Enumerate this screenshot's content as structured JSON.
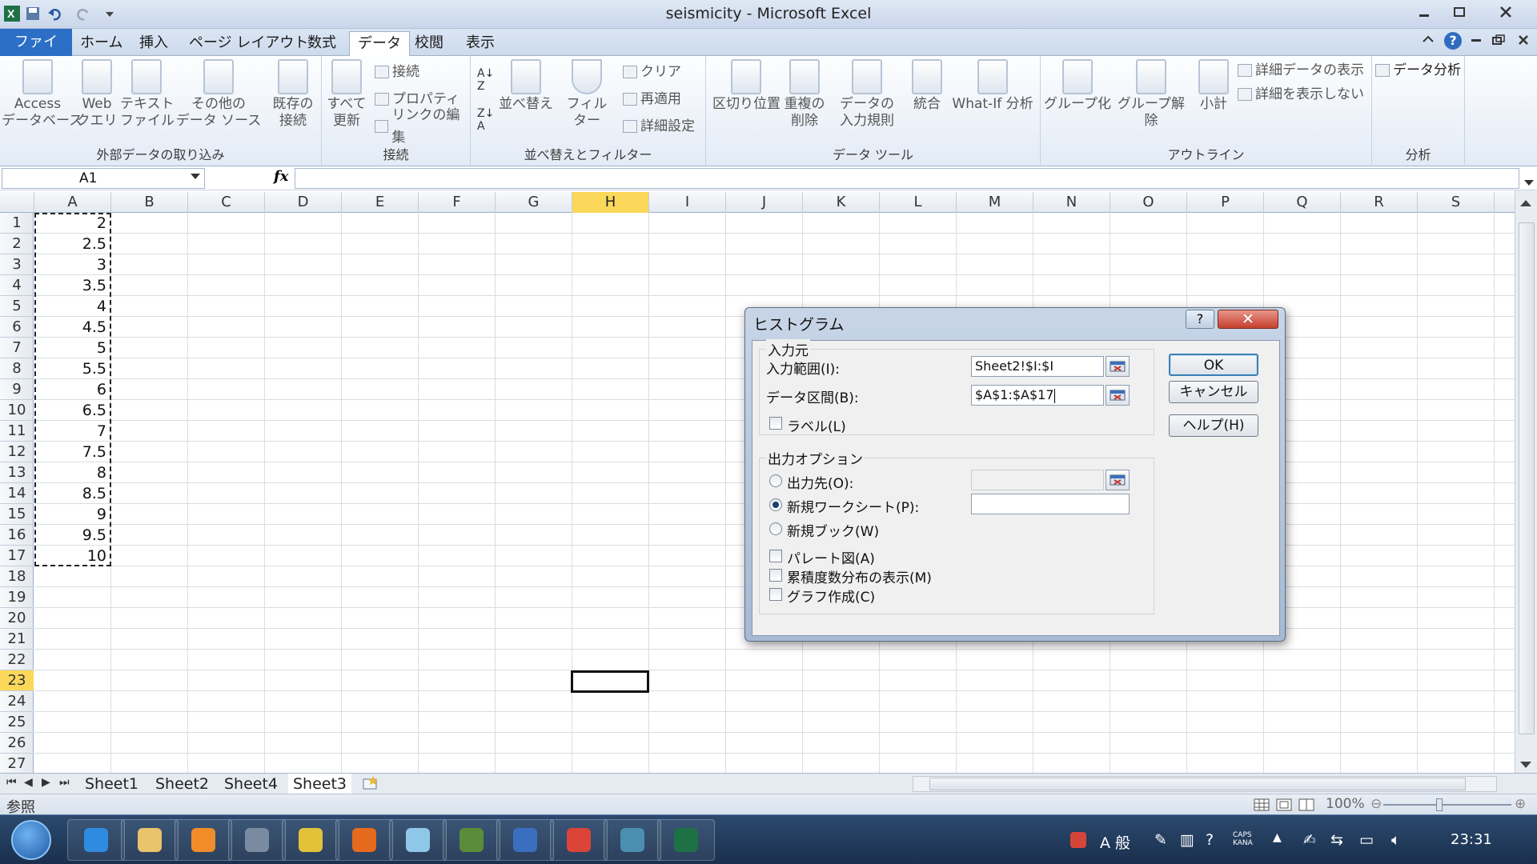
{
  "window": {
    "title": "seismicity - Microsoft Excel"
  },
  "tabs": [
    {
      "label": "ファイル"
    },
    {
      "label": "ホーム"
    },
    {
      "label": "挿入"
    },
    {
      "label": "ページ レイアウト"
    },
    {
      "label": "数式"
    },
    {
      "label": "データ"
    },
    {
      "label": "校閲"
    },
    {
      "label": "表示"
    }
  ],
  "ribbon": {
    "groups": {
      "external": "外部データの取り込み",
      "connections": "接続",
      "sortfilter": "並べ替えとフィルター",
      "datatools": "データ ツール",
      "outline": "アウトライン",
      "analysis": "分析"
    },
    "external_buttons": [
      {
        "label": "Access\nデータベース"
      },
      {
        "label": "Web\nクエリ"
      },
      {
        "label": "テキスト\nファイル"
      },
      {
        "label": "その他の\nデータ ソース"
      },
      {
        "label": "既存の\n接続"
      }
    ],
    "refresh": "すべて\n更新",
    "conn_small": [
      "接続",
      "プロパティ",
      "リンクの編集"
    ],
    "sort": "並べ替え",
    "filter": "フィルター",
    "filter_small": [
      "クリア",
      "再適用",
      "詳細設定"
    ],
    "datatools_buttons": [
      {
        "label": "区切り位置"
      },
      {
        "label": "重複の\n削除"
      },
      {
        "label": "データの\n入力規則"
      },
      {
        "label": "統合"
      },
      {
        "label": "What-If 分析"
      }
    ],
    "outline_buttons": [
      {
        "label": "グループ化"
      },
      {
        "label": "グループ解除"
      },
      {
        "label": "小計"
      }
    ],
    "outline_small": [
      "詳細データの表示",
      "詳細を表示しない"
    ],
    "analysis_button": "データ分析"
  },
  "formula_bar": {
    "name_box": "A1",
    "fx": "fx",
    "content": ""
  },
  "columns": [
    "A",
    "B",
    "C",
    "D",
    "E",
    "F",
    "G",
    "H",
    "I",
    "J",
    "K",
    "L",
    "M",
    "N",
    "O",
    "P",
    "Q",
    "R",
    "S"
  ],
  "selected_column": "H",
  "rows": [
    "1",
    "2",
    "3",
    "4",
    "5",
    "6",
    "7",
    "8",
    "9",
    "10",
    "11",
    "12",
    "13",
    "14",
    "15",
    "16",
    "17",
    "18",
    "19",
    "20",
    "21",
    "22",
    "23",
    "24",
    "25",
    "26",
    "27"
  ],
  "selected_row": "23",
  "column_a_values": [
    "2",
    "2.5",
    "3",
    "3.5",
    "4",
    "4.5",
    "5",
    "5.5",
    "6",
    "6.5",
    "7",
    "7.5",
    "8",
    "8.5",
    "9",
    "9.5",
    "10"
  ],
  "sheet_tabs": [
    "Sheet1",
    "Sheet2",
    "Sheet4",
    "Sheet3"
  ],
  "active_sheet": "Sheet3",
  "status": {
    "mode": "参照",
    "zoom": "100%"
  },
  "dialog": {
    "title": "ヒストグラム",
    "help_btn": "?",
    "close_btn": "✕",
    "input_section": "入力元",
    "input_range_label": "入力範囲(I):",
    "input_range_value": "Sheet2!$I:$I",
    "bin_range_label": "データ区間(B):",
    "bin_range_value": "$A$1:$A$17",
    "labels_label": "ラベル(L)",
    "output_section": "出力オプション",
    "output_range_label": "出力先(O):",
    "new_sheet_label": "新規ワークシート(P):",
    "new_workbook_label": "新規ブック(W)",
    "pareto_label": "パレート図(A)",
    "cumulative_label": "累積度数分布の表示(M)",
    "chart_label": "グラフ作成(C)",
    "ok": "OK",
    "cancel": "キャンセル",
    "help": "ヘルプ(H)",
    "selected_output": "new_sheet"
  },
  "taskbar": {
    "clock": "23:31",
    "ime": "A 般",
    "apps": [
      "internet-explorer",
      "file-explorer",
      "media-player",
      "network-tool",
      "tool-t",
      "illustrator",
      "notes",
      "security-tool",
      "word-like",
      "chrome",
      "image-viewer",
      "excel"
    ]
  }
}
